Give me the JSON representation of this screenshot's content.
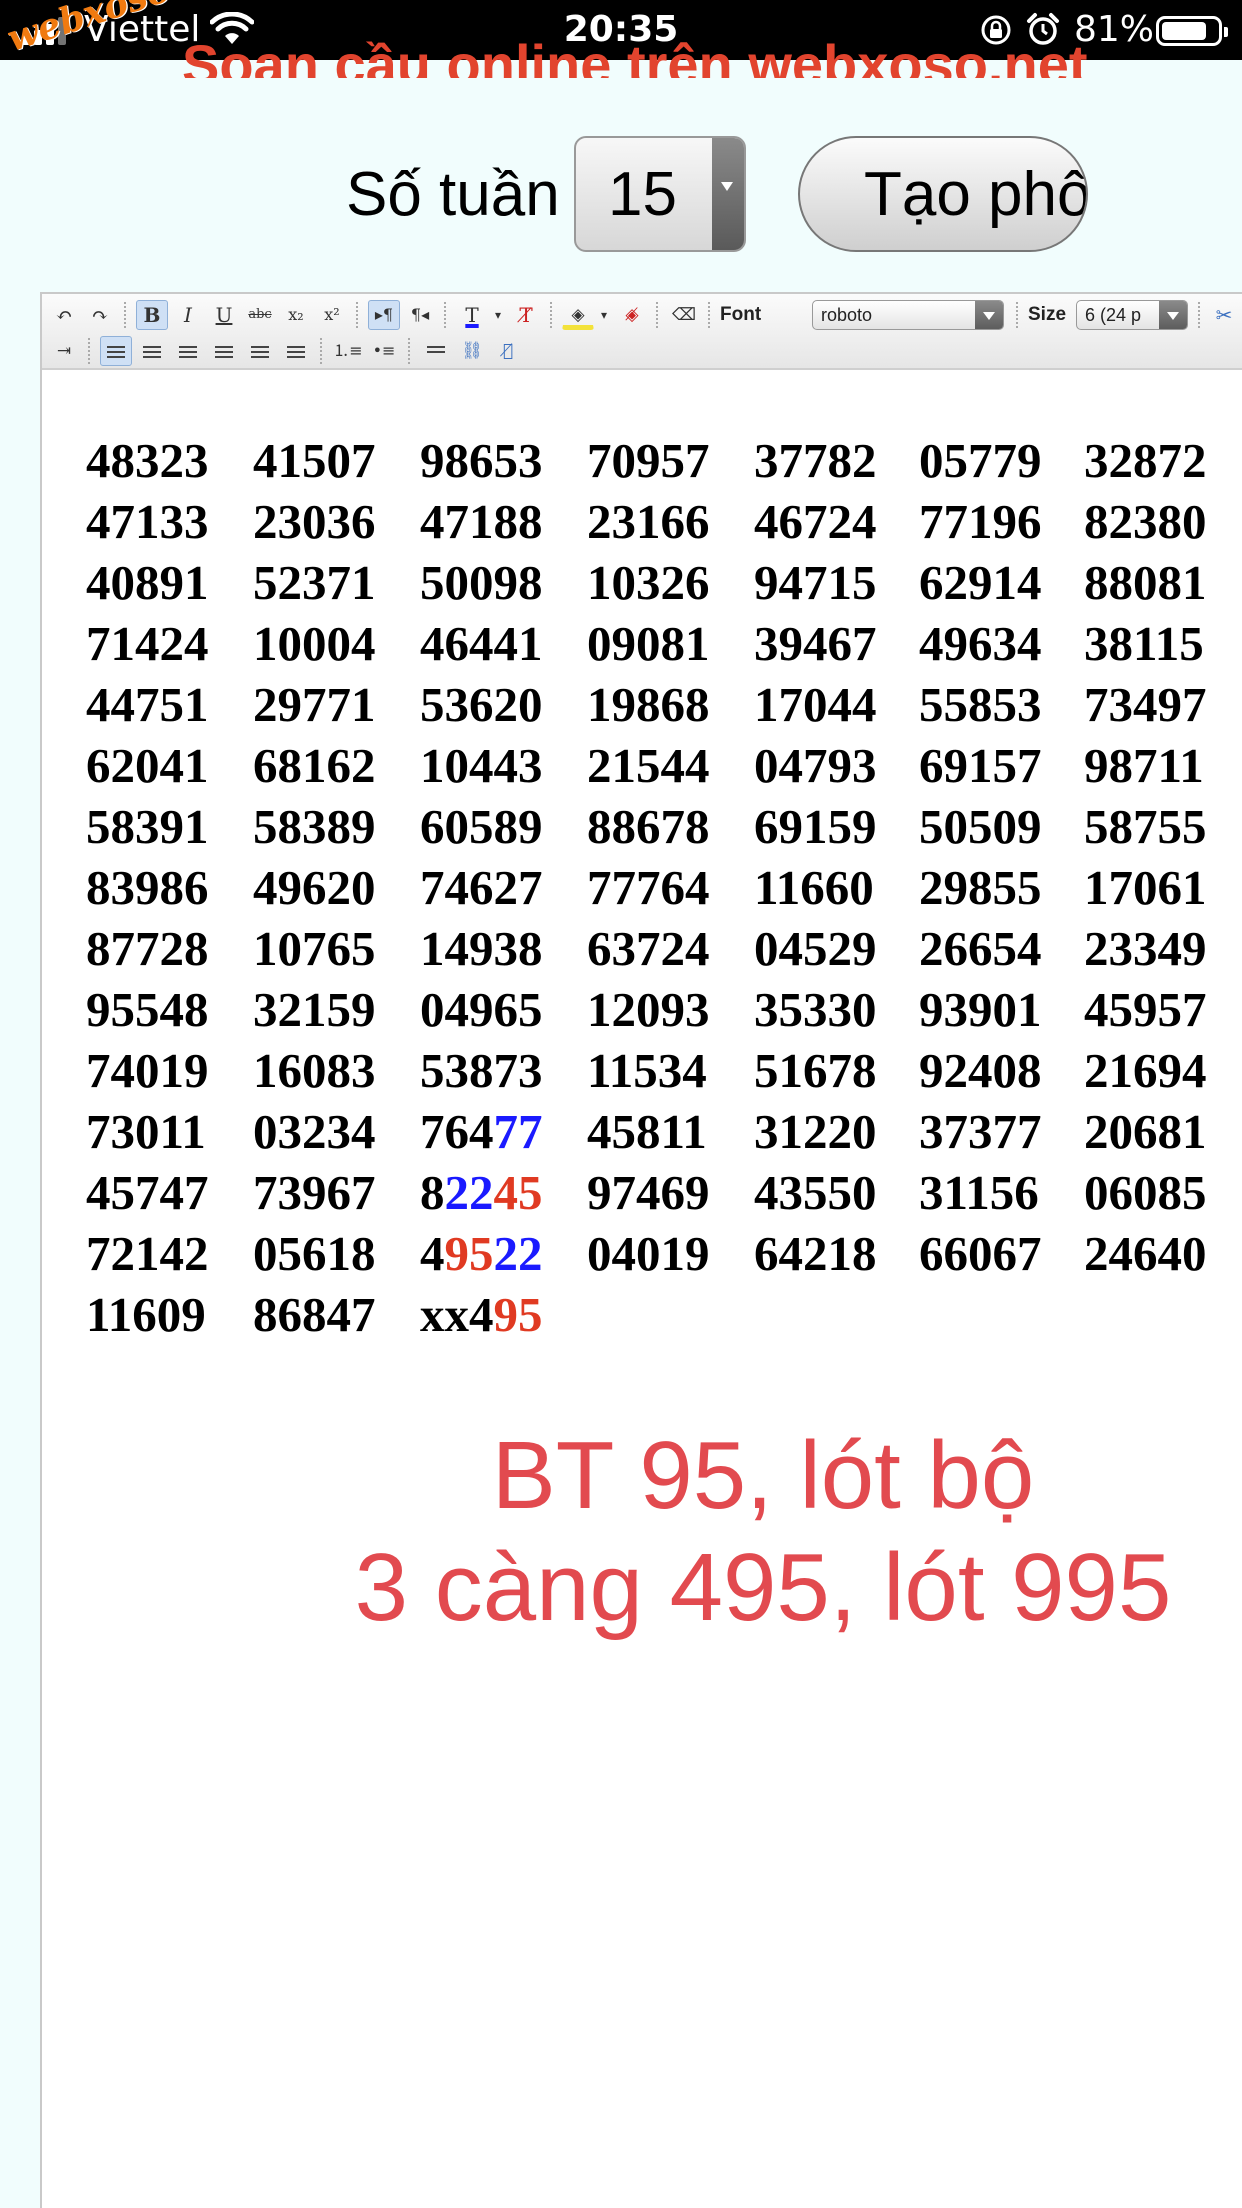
{
  "status_bar": {
    "carrier": "Viettel",
    "time": "20:35",
    "battery_percent": "81%",
    "battery_level": 0.81
  },
  "watermark": "webxoso.net",
  "page": {
    "heading": "Soạn cầu online trên webxoso.net",
    "weeks_label": "Số tuần",
    "weeks_value": "15",
    "generate_button": "Tạo phô"
  },
  "editor": {
    "font_label": "Font",
    "font_value": "roboto",
    "size_label": "Size",
    "size_value": "6 (24 p"
  },
  "number_rows": [
    [
      [
        "48323"
      ],
      [
        "41507"
      ],
      [
        "98653"
      ],
      [
        "70957"
      ],
      [
        "37782"
      ],
      [
        "05779"
      ],
      [
        "32872"
      ]
    ],
    [
      [
        "47133"
      ],
      [
        "23036"
      ],
      [
        "47188"
      ],
      [
        "23166"
      ],
      [
        "46724"
      ],
      [
        "77196"
      ],
      [
        "82380"
      ]
    ],
    [
      [
        "40891"
      ],
      [
        "52371"
      ],
      [
        "50098"
      ],
      [
        "10326"
      ],
      [
        "94715"
      ],
      [
        "62914"
      ],
      [
        "88081"
      ]
    ],
    [
      [
        "71424"
      ],
      [
        "10004"
      ],
      [
        "46441"
      ],
      [
        "09081"
      ],
      [
        "39467"
      ],
      [
        "49634"
      ],
      [
        "38115"
      ]
    ],
    [
      [
        "44751"
      ],
      [
        "29771"
      ],
      [
        "53620"
      ],
      [
        "19868"
      ],
      [
        "17044"
      ],
      [
        "55853"
      ],
      [
        "73497"
      ]
    ],
    [
      [
        "62041"
      ],
      [
        "68162"
      ],
      [
        "10443"
      ],
      [
        "21544"
      ],
      [
        "04793"
      ],
      [
        "69157"
      ],
      [
        "98711"
      ]
    ],
    [
      [
        "58391"
      ],
      [
        "58389"
      ],
      [
        "60589"
      ],
      [
        "88678"
      ],
      [
        "69159"
      ],
      [
        "50509"
      ],
      [
        "58755"
      ]
    ],
    [
      [
        "83986"
      ],
      [
        "49620"
      ],
      [
        "74627"
      ],
      [
        "77764"
      ],
      [
        "11660"
      ],
      [
        "29855"
      ],
      [
        "17061"
      ]
    ],
    [
      [
        "87728"
      ],
      [
        "10765"
      ],
      [
        "14938"
      ],
      [
        "63724"
      ],
      [
        "04529"
      ],
      [
        "26654"
      ],
      [
        "23349"
      ]
    ],
    [
      [
        "95548"
      ],
      [
        "32159"
      ],
      [
        "04965"
      ],
      [
        "12093"
      ],
      [
        "35330"
      ],
      [
        "93901"
      ],
      [
        "45957"
      ]
    ],
    [
      [
        "74019"
      ],
      [
        "16083"
      ],
      [
        "53873"
      ],
      [
        "11534"
      ],
      [
        "51678"
      ],
      [
        "92408"
      ],
      [
        "21694"
      ]
    ],
    [
      [
        "73011"
      ],
      [
        "03234"
      ],
      [
        "764",
        "77"
      ],
      [
        "45811"
      ],
      [
        "31220"
      ],
      [
        "37377"
      ],
      [
        "20681"
      ]
    ],
    [
      [
        "45747"
      ],
      [
        "73967"
      ],
      [
        "8",
        "22",
        "45"
      ],
      [
        "97469"
      ],
      [
        "43550"
      ],
      [
        "31156"
      ],
      [
        "06085"
      ]
    ],
    [
      [
        "72142"
      ],
      [
        "05618"
      ],
      [
        "4",
        "95",
        "22"
      ],
      [
        "04019"
      ],
      [
        "64218"
      ],
      [
        "66067"
      ],
      [
        "24640"
      ]
    ],
    [
      [
        "11609"
      ],
      [
        "86847"
      ],
      [
        "xx4",
        "95"
      ]
    ]
  ],
  "highlight_colors": {
    "red": "#e03a22",
    "blue": "#1a1aff"
  },
  "prediction": {
    "line1": "BT 95, lót bộ",
    "line2": "3 càng 495, lót 995",
    "color": "#e24a4f"
  }
}
